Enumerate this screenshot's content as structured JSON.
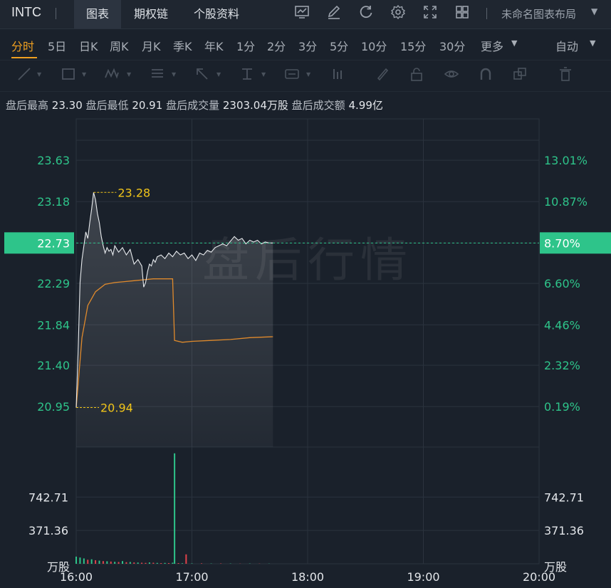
{
  "header": {
    "ticker": "INTC",
    "tabs": [
      "图表",
      "期权链",
      "个股资料"
    ],
    "active_tab": "图表",
    "icons": [
      "chart-settings-icon",
      "draw-icon",
      "refresh-icon",
      "gear-icon",
      "fullscreen-icon",
      "grid-layout-icon"
    ],
    "layout_label": "未命名图表布局"
  },
  "periods": {
    "items": [
      "分时",
      "5日",
      "日K",
      "周K",
      "月K",
      "季K",
      "年K",
      "1分",
      "2分",
      "3分",
      "5分",
      "10分",
      "15分",
      "30分",
      "更多"
    ],
    "active": "分时",
    "adjust_label": "自动"
  },
  "tools": [
    "line-tool-icon",
    "rect-tool-icon",
    "wave-tool-icon",
    "fib-tool-icon",
    "arrow-tool-icon",
    "text-align-tool-icon",
    "label-tool-icon",
    "measure-tool-icon",
    "brush-icon",
    "lock-icon",
    "eye-icon",
    "magnet-icon",
    "layers-icon",
    "trash-icon"
  ],
  "info": {
    "high_label": "盘后最高",
    "high_value": "23.30",
    "low_label": "盘后最低",
    "low_value": "20.91",
    "volume_label": "盘后成交量",
    "volume_value": "2303.04万股",
    "amount_label": "盘后成交额",
    "amount_value": "4.99亿"
  },
  "colors": {
    "up": "#2ec48a",
    "down": "#e0424a",
    "avg_line": "#e08a2c",
    "price_line": "#e9ecef",
    "marker": "#f0c419",
    "active_tab": "#f0a020"
  },
  "chart_data": {
    "type": "line",
    "title": "",
    "watermark": "盘后行情",
    "x_ticks": [
      "16:00",
      "17:00",
      "18:00",
      "19:00",
      "20:00"
    ],
    "x_range": [
      "16:00",
      "20:00"
    ],
    "y_ticks": [
      "23.63",
      "23.18",
      "22.73",
      "22.29",
      "21.84",
      "21.40",
      "20.95"
    ],
    "y_range": [
      20.51,
      24.08
    ],
    "pct_ticks": [
      "13.01%",
      "10.87%",
      "8.70%",
      "6.60%",
      "4.46%",
      "2.32%",
      "0.19%"
    ],
    "current_price": "22.73",
    "current_pct": "8.70%",
    "max_marker": "23.28",
    "min_marker": "20.94",
    "volume_ticks": [
      "742.71",
      "371.36"
    ],
    "volume_unit": "万股",
    "grid": true,
    "series": [
      {
        "name": "",
        "x": [
          "16:00",
          "16:01",
          "16:02",
          "16:03",
          "16:04",
          "16:05",
          "16:06",
          "16:07",
          "16:08",
          "16:09",
          "16:10",
          "16:11",
          "16:12",
          "16:13",
          "16:14",
          "16:15",
          "16:16",
          "16:17",
          "16:18",
          "16:19",
          "16:20",
          "16:22",
          "16:24",
          "16:26",
          "16:28",
          "16:30",
          "16:32",
          "16:34",
          "16:35",
          "16:36",
          "16:37",
          "16:38",
          "16:39",
          "16:40",
          "16:41",
          "16:42",
          "16:44",
          "16:46",
          "16:48",
          "16:50",
          "16:52",
          "16:54",
          "16:56",
          "16:58",
          "17:00",
          "17:02",
          "17:04",
          "17:06",
          "17:08",
          "17:10",
          "17:12",
          "17:14",
          "17:16",
          "17:18",
          "17:20",
          "17:22",
          "17:24",
          "17:26",
          "17:28",
          "17:30",
          "17:32",
          "17:34",
          "17:36",
          "17:38",
          "17:40",
          "17:42"
        ],
        "values": [
          20.94,
          21.55,
          22.3,
          22.55,
          22.7,
          22.85,
          22.78,
          22.95,
          23.1,
          23.28,
          23.2,
          23.05,
          22.95,
          22.8,
          22.7,
          22.62,
          22.68,
          22.64,
          22.66,
          22.6,
          22.7,
          22.63,
          22.68,
          22.6,
          22.66,
          22.5,
          22.55,
          22.48,
          22.25,
          22.3,
          22.42,
          22.5,
          22.48,
          22.55,
          22.52,
          22.58,
          22.6,
          22.56,
          22.62,
          22.58,
          22.64,
          22.6,
          22.62,
          22.56,
          22.6,
          22.54,
          22.62,
          22.6,
          22.65,
          22.63,
          22.68,
          22.7,
          22.72,
          22.7,
          22.75,
          22.8,
          22.76,
          22.78,
          22.72,
          22.76,
          22.74,
          22.76,
          22.72,
          22.74,
          22.73,
          22.73
        ]
      },
      {
        "name": "",
        "x": [
          "16:00",
          "16:03",
          "16:06",
          "16:10",
          "16:15",
          "16:20",
          "16:25",
          "16:30",
          "16:35",
          "16:40",
          "16:45",
          "16:50",
          "16:51",
          "16:55",
          "17:00",
          "17:10",
          "17:20",
          "17:30",
          "17:42"
        ],
        "values": [
          20.94,
          21.7,
          22.05,
          22.2,
          22.28,
          22.3,
          22.31,
          22.32,
          22.33,
          22.34,
          22.34,
          22.34,
          21.67,
          21.65,
          21.66,
          21.67,
          21.68,
          21.7,
          21.71
        ]
      }
    ],
    "volume": {
      "x": [
        "16:00",
        "16:02",
        "16:04",
        "16:06",
        "16:08",
        "16:10",
        "16:12",
        "16:14",
        "16:16",
        "16:18",
        "16:20",
        "16:22",
        "16:24",
        "16:26",
        "16:28",
        "16:30",
        "16:32",
        "16:34",
        "16:36",
        "16:38",
        "16:40",
        "16:42",
        "16:44",
        "16:46",
        "16:48",
        "16:50",
        "16:51",
        "16:53",
        "16:55",
        "16:57",
        "17:00",
        "17:05",
        "17:10",
        "17:15",
        "17:20",
        "17:25",
        "17:30",
        "17:35",
        "17:40"
      ],
      "values": [
        80,
        70,
        60,
        45,
        50,
        40,
        35,
        30,
        28,
        25,
        22,
        20,
        30,
        18,
        20,
        15,
        14,
        12,
        10,
        15,
        12,
        10,
        8,
        10,
        8,
        12,
        1230,
        8,
        6,
        105,
        4,
        5,
        3,
        4,
        3,
        2,
        3,
        2,
        2
      ],
      "direction": [
        "up",
        "up",
        "up",
        "down",
        "up",
        "down",
        "up",
        "down",
        "up",
        "down",
        "up",
        "down",
        "up",
        "down",
        "up",
        "down",
        "up",
        "down",
        "down",
        "up",
        "down",
        "up",
        "down",
        "up",
        "down",
        "up",
        "up",
        "down",
        "up",
        "down",
        "up",
        "down",
        "up",
        "down",
        "up",
        "down",
        "up",
        "down",
        "up"
      ]
    }
  }
}
